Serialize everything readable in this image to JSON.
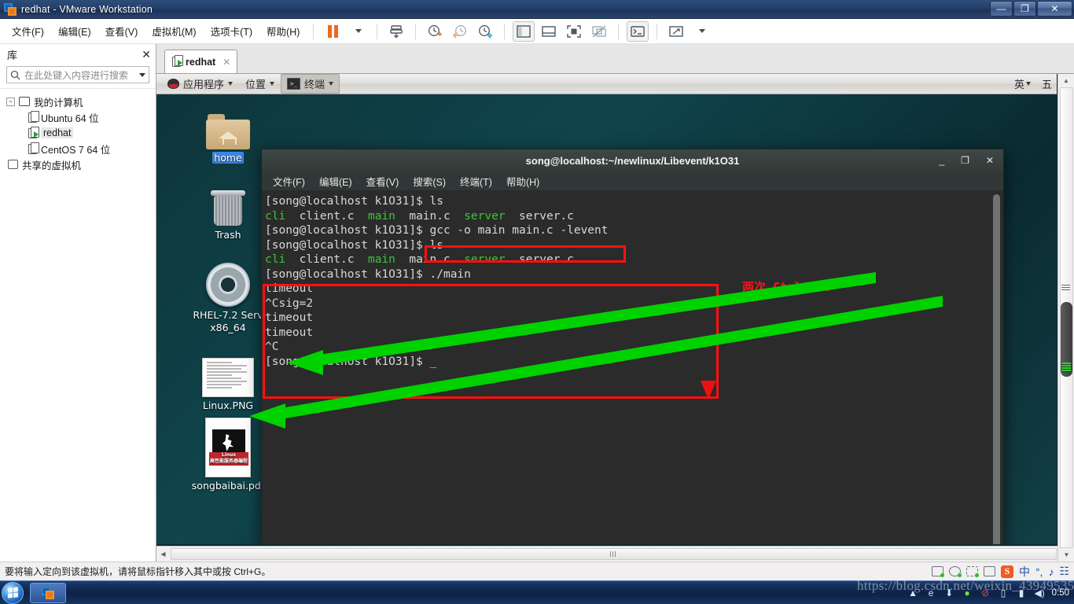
{
  "window": {
    "title": "redhat - VMware Workstation",
    "buttons": {
      "minimize": "—",
      "maximize": "❐",
      "close": "✕"
    }
  },
  "menubar": {
    "items": [
      {
        "label": "文件(F)"
      },
      {
        "label": "编辑(E)"
      },
      {
        "label": "查看(V)"
      },
      {
        "label": "虚拟机(M)"
      },
      {
        "label": "选项卡(T)"
      },
      {
        "label": "帮助(H)"
      }
    ]
  },
  "toolbar": {
    "icons": [
      {
        "name": "pause-vm-icon"
      },
      {
        "name": "dropdown-caret-icon"
      },
      {
        "name": "snapshot-manager-icon"
      },
      {
        "name": "take-snapshot-icon"
      },
      {
        "name": "revert-snapshot-icon"
      },
      {
        "name": "manage-snapshots-icon"
      },
      {
        "name": "show-library-icon"
      },
      {
        "name": "show-thumbnail-bar-icon"
      },
      {
        "name": "fullscreen-icon"
      },
      {
        "name": "unity-mode-icon"
      },
      {
        "name": "console-view-icon"
      },
      {
        "name": "stretch-guest-icon"
      },
      {
        "name": "dropdown-caret-icon-2"
      }
    ]
  },
  "library": {
    "title": "库",
    "close": "✕",
    "search_placeholder": "在此处键入内容进行搜索",
    "tree": [
      {
        "label": "我的计算机",
        "level": 0,
        "icon": "monitor-icon",
        "expander": "−",
        "selected": false
      },
      {
        "label": "Ubuntu 64 位",
        "level": 1,
        "icon": "vm-icon",
        "selected": false
      },
      {
        "label": "redhat",
        "level": 1,
        "icon": "vm-running-icon",
        "selected": true
      },
      {
        "label": "CentOS 7 64 位",
        "level": 1,
        "icon": "vm-icon",
        "selected": false
      },
      {
        "label": "共享的虚拟机",
        "level": 0,
        "icon": "shared-vm-icon",
        "selected": false
      }
    ]
  },
  "tabs": [
    {
      "label": "redhat",
      "close": "✕",
      "active": true
    }
  ],
  "guest": {
    "panel": {
      "applications": "应用程序",
      "places": "位置",
      "terminal": "终端",
      "ime_lang": "英",
      "ime_mode": "五"
    },
    "desktop_icons": [
      {
        "name": "home-folder-icon",
        "label": "home",
        "selected": true
      },
      {
        "name": "trash-icon",
        "label": "Trash",
        "selected": false
      },
      {
        "name": "cdrom-icon",
        "label": "RHEL-7.2 Serv\nx86_64",
        "selected": false
      },
      {
        "name": "image-file-icon",
        "label": "Linux.PNG",
        "selected": false
      },
      {
        "name": "pdf-file-icon",
        "label": "songbaibai.pdf",
        "selected": false
      }
    ]
  },
  "terminal": {
    "title": "song@localhost:~/newlinux/Libevent/k1O31",
    "window_buttons": {
      "minimize": "_",
      "maximize": "❐",
      "close": "✕"
    },
    "menus": [
      {
        "label": "文件(F)"
      },
      {
        "label": "编辑(E)"
      },
      {
        "label": "查看(V)"
      },
      {
        "label": "搜索(S)"
      },
      {
        "label": "终端(T)"
      },
      {
        "label": "帮助(H)"
      }
    ],
    "lines": [
      {
        "segments": [
          {
            "t": "[song@localhost k1O31]$ ls",
            "c": "white"
          }
        ]
      },
      {
        "segments": [
          {
            "t": "cli",
            "c": "green"
          },
          {
            "t": "  client.c  ",
            "c": "white"
          },
          {
            "t": "main",
            "c": "green"
          },
          {
            "t": "  main.c  ",
            "c": "white"
          },
          {
            "t": "server",
            "c": "green"
          },
          {
            "t": "  server.c",
            "c": "white"
          }
        ]
      },
      {
        "segments": [
          {
            "t": "[song@localhost k1O31]$ gcc -o main main.c -levent",
            "c": "white"
          }
        ]
      },
      {
        "segments": [
          {
            "t": "[song@localhost k1O31]$ ls",
            "c": "white"
          }
        ]
      },
      {
        "segments": [
          {
            "t": "cli",
            "c": "green"
          },
          {
            "t": "  client.c  ",
            "c": "white"
          },
          {
            "t": "main",
            "c": "green"
          },
          {
            "t": "  main.c  ",
            "c": "white"
          },
          {
            "t": "server",
            "c": "green"
          },
          {
            "t": "  server.c",
            "c": "white"
          }
        ]
      },
      {
        "segments": [
          {
            "t": "[song@localhost k1O31]$ ./main",
            "c": "white"
          }
        ]
      },
      {
        "segments": [
          {
            "t": "timeout",
            "c": "white"
          }
        ]
      },
      {
        "segments": [
          {
            "t": "^Csig=2",
            "c": "white"
          }
        ]
      },
      {
        "segments": [
          {
            "t": "timeout",
            "c": "white"
          }
        ]
      },
      {
        "segments": [
          {
            "t": "timeout",
            "c": "white"
          }
        ]
      },
      {
        "segments": [
          {
            "t": "^C",
            "c": "white"
          }
        ]
      },
      {
        "segments": [
          {
            "t": "[song@localhost k1O31]$ _",
            "c": "white"
          }
        ]
      }
    ]
  },
  "annotations": {
    "highlight_color": "#ff1111",
    "arrow_color": "#00d200",
    "note": "两次  Ctrl + C"
  },
  "status_bar": {
    "message": "要将输入定向到该虚拟机，请将鼠标指针移入其中或按 Ctrl+G。",
    "icons": [
      {
        "name": "hard-disk-icon"
      },
      {
        "name": "cd-dvd-icon"
      },
      {
        "name": "network-adapter-icon"
      },
      {
        "name": "printer-icon"
      },
      {
        "name": "usb-icon"
      }
    ],
    "ime": [
      {
        "name": "sogou-icon",
        "label": "S"
      },
      {
        "name": "chinese-mode-icon",
        "label": "中"
      },
      {
        "name": "punctuation-icon",
        "label": "°,"
      },
      {
        "name": "voice-input-icon",
        "label": "♪"
      },
      {
        "name": "toolbox-icon",
        "label": "☷"
      }
    ]
  },
  "taskbar": {
    "start": "start-orb",
    "items": [
      {
        "name": "vmware-taskbar-button"
      }
    ],
    "tray": [
      {
        "name": "show-hidden-icons",
        "label": "▲"
      },
      {
        "name": "browser-icon",
        "label": "e"
      },
      {
        "name": "update-icon",
        "label": "⬇"
      },
      {
        "name": "antivirus-icon",
        "label": "●"
      },
      {
        "name": "blocked-icon",
        "label": "⊘"
      },
      {
        "name": "battery-icon",
        "label": "▯"
      },
      {
        "name": "network-icon",
        "label": "▮"
      },
      {
        "name": "volume-icon",
        "label": "◀)"
      }
    ],
    "clock": "0:50"
  },
  "watermark": "https://blog.csdn.net/weixin_43949535"
}
